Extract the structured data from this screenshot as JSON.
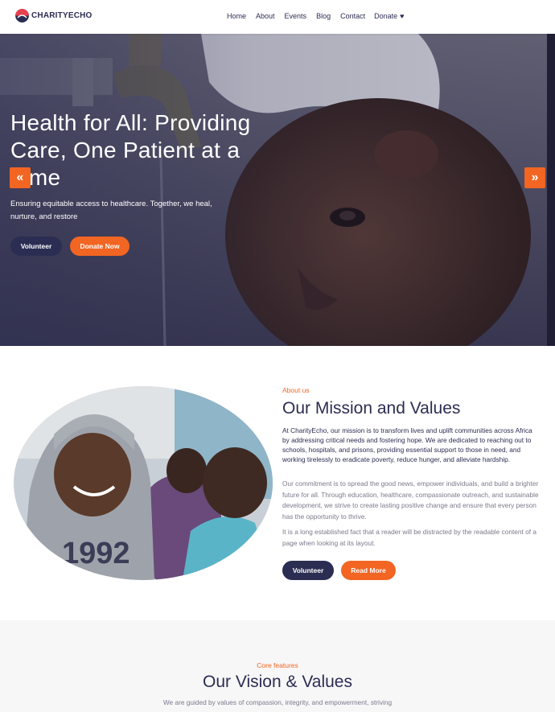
{
  "brand": {
    "name": "CHARITYECHO",
    "colors": {
      "navy": "#2b2d52",
      "orange": "#f26522"
    }
  },
  "nav": {
    "home": "Home",
    "about": "About",
    "events": "Events",
    "blog": "Blog",
    "contact": "Contact",
    "donate": "Donate",
    "donate_icon": "heart-icon"
  },
  "hero": {
    "title": "Health for All: Providing Care, One Patient at a Time",
    "subtitle": "Ensuring equitable access to healthcare. Together, we heal, nurture, and restore",
    "prev_icon": "«",
    "next_icon": "»",
    "volunteer_label": "Volunteer",
    "donate_label": "Donate Now"
  },
  "about": {
    "eyebrow": "About us",
    "title": "Our Mission and Values",
    "lead": "At CharityEcho, our mission is to transform lives and uplift communities across Africa by addressing critical needs and fostering hope. We are dedicated to reaching out to schools, hospitals, and prisons, providing essential support to those in need, and working tirelessly to eradicate poverty, reduce hunger, and alleviate hardship.",
    "p2": "Our commitment is to spread the good news, empower individuals, and build a brighter future for all. Through education, healthcare, compassionate outreach, and sustainable development, we strive to create lasting positive change and ensure that every person has the opportunity to thrive.",
    "p3": "It is a long established fact that a reader will be distracted by the readable content of a page when looking at its layout.",
    "volunteer_label": "Volunteer",
    "read_more_label": "Read More"
  },
  "features": {
    "eyebrow": "Core features",
    "title": "Our Vision & Values",
    "desc": "We are guided by values of compassion, integrity, and empowerment, striving"
  }
}
